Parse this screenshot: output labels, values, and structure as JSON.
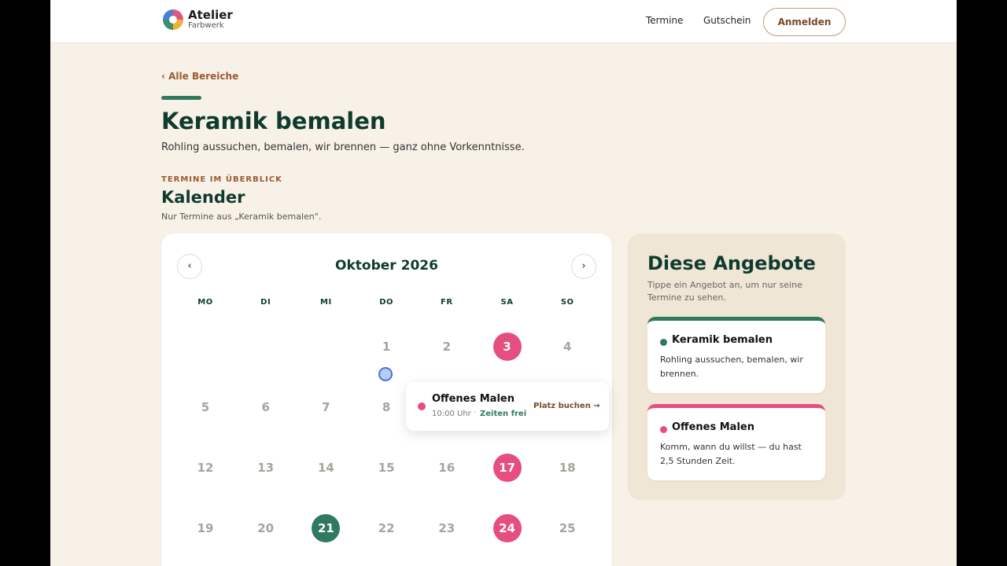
{
  "header": {
    "brand_title": "Atelier",
    "brand_sub": "Farbwerk",
    "nav": [
      "Termine",
      "Gutschein"
    ],
    "login_label": "Anmelden"
  },
  "breadcrumb": "‹ Alle Bereiche",
  "title": "Keramik bemalen",
  "lead": "Rohling aussuchen, bemalen, wir brennen — ganz ohne Vorkenntnisse.",
  "section": {
    "eyebrow": "TERMINE IM ÜBERBLICK",
    "heading": "Kalender",
    "note": "Nur Termine aus „Keramik bemalen\"."
  },
  "calendar": {
    "month": "Oktober 2026",
    "prev_icon": "‹",
    "next_icon": "›",
    "weekdays": [
      "MO",
      "DI",
      "MI",
      "DO",
      "FR",
      "SA",
      "SO"
    ],
    "days": [
      {
        "label": "1",
        "col": 3,
        "row": 0,
        "status": ""
      },
      {
        "label": "2",
        "col": 4,
        "row": 0,
        "status": ""
      },
      {
        "label": "3",
        "col": 5,
        "row": 0,
        "status": "pink"
      },
      {
        "label": "4",
        "col": 6,
        "row": 0,
        "status": ""
      },
      {
        "label": "5",
        "col": 0,
        "row": 1,
        "status": ""
      },
      {
        "label": "6",
        "col": 1,
        "row": 1,
        "status": ""
      },
      {
        "label": "7",
        "col": 2,
        "row": 1,
        "status": ""
      },
      {
        "label": "8",
        "col": 3,
        "row": 1,
        "status": ""
      },
      {
        "label": "12",
        "col": 0,
        "row": 2,
        "status": ""
      },
      {
        "label": "13",
        "col": 1,
        "row": 2,
        "status": ""
      },
      {
        "label": "14",
        "col": 2,
        "row": 2,
        "status": ""
      },
      {
        "label": "15",
        "col": 3,
        "row": 2,
        "status": ""
      },
      {
        "label": "16",
        "col": 4,
        "row": 2,
        "status": ""
      },
      {
        "label": "17",
        "col": 5,
        "row": 2,
        "status": "pink"
      },
      {
        "label": "18",
        "col": 6,
        "row": 2,
        "status": ""
      },
      {
        "label": "19",
        "col": 0,
        "row": 3,
        "status": ""
      },
      {
        "label": "20",
        "col": 1,
        "row": 3,
        "status": ""
      },
      {
        "label": "21",
        "col": 2,
        "row": 3,
        "status": "green"
      },
      {
        "label": "22",
        "col": 3,
        "row": 3,
        "status": ""
      },
      {
        "label": "23",
        "col": 4,
        "row": 3,
        "status": ""
      },
      {
        "label": "24",
        "col": 5,
        "row": 3,
        "status": "pink"
      },
      {
        "label": "25",
        "col": 6,
        "row": 3,
        "status": ""
      }
    ]
  },
  "popup": {
    "title": "Offenes Malen",
    "time": "10:00 Uhr",
    "separator": "·",
    "availability": "Zeiten frei",
    "action": "Platz buchen →"
  },
  "offers": {
    "title": "Diese Angebote",
    "subtitle": "Tippe ein Angebot an, um nur seine Termine zu sehen.",
    "items": [
      {
        "name": "Keramik bemalen",
        "desc": "Rohling aussuchen, bemalen, wir brennen.",
        "color": "#2f7a5e"
      },
      {
        "name": "Offenes Malen",
        "desc": "Komm, wann du willst — du hast 2,5 Stunden Zeit.",
        "color": "#e54e7e"
      }
    ]
  },
  "colors": {
    "accent_green": "#2f7a5e",
    "accent_pink": "#e54e7e",
    "brand_brown": "#9a5b32",
    "heading": "#0f3b2e",
    "background": "#f8f1e7"
  }
}
